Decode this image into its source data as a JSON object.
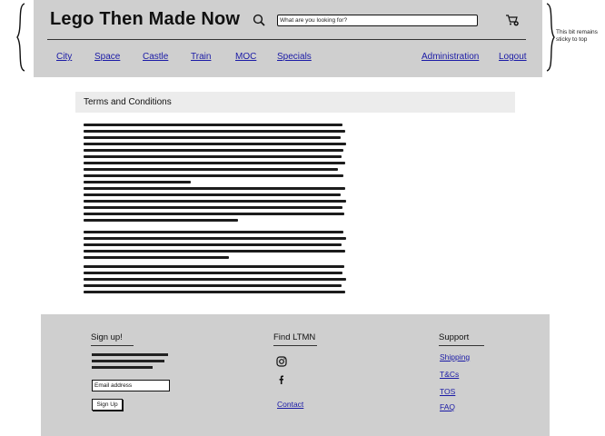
{
  "header": {
    "title": "Lego Then Made Now",
    "search_placeholder": "What are you looking for?",
    "nav_left": [
      "City",
      "Space",
      "Castle",
      "Train",
      "MOC",
      "Specials"
    ],
    "nav_right": [
      "Administration",
      "Logout"
    ]
  },
  "annotation": {
    "note": "This bit remains sticky to top"
  },
  "content": {
    "section_title": "Terms and Conditions"
  },
  "footer": {
    "signup": {
      "heading": "Sign up!",
      "email_placeholder": "Email address",
      "button_label": "Sign Up"
    },
    "find": {
      "heading": "Find LTMN",
      "contact_label": "Contact",
      "icons": [
        "instagram-icon",
        "facebook-icon"
      ]
    },
    "support": {
      "heading": "Support",
      "links": [
        "Shipping",
        "T&Cs",
        "TOS",
        "FAQ"
      ]
    }
  },
  "colors": {
    "header_bg": "#cfcfcf",
    "footer_bg": "#cfcfcf",
    "link": "#1a1aa6",
    "tc_bar_bg": "#ececec"
  }
}
